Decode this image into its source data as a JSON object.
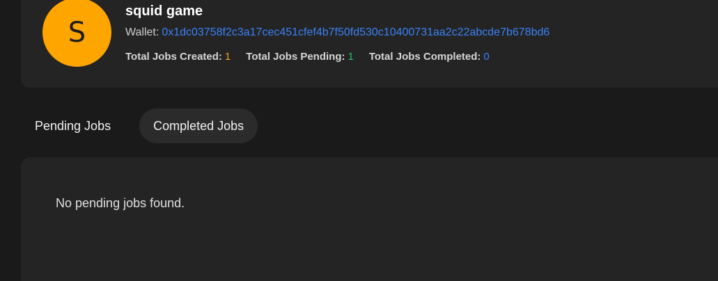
{
  "colors": {
    "avatar_bg": "#FFA500",
    "wallet_link": "#3b82f6",
    "created_value": "#f0a020",
    "pending_value": "#22c55e",
    "completed_value": "#3b82f6"
  },
  "profile": {
    "avatar_initial": "S",
    "name": "squid game",
    "wallet_label": "Wallet:",
    "wallet_address": "0x1dc03758f2c3a17cec451cfef4b7f50fd530c10400731aa2c22abcde7b678bd6",
    "stats": [
      {
        "label": "Total Jobs Created:",
        "value": "1"
      },
      {
        "label": "Total Jobs Pending:",
        "value": "1"
      },
      {
        "label": "Total Jobs Completed:",
        "value": "0"
      }
    ]
  },
  "tabs": [
    {
      "label": "Pending Jobs"
    },
    {
      "label": "Completed Jobs"
    }
  ],
  "content": {
    "empty_message": "No pending jobs found."
  }
}
